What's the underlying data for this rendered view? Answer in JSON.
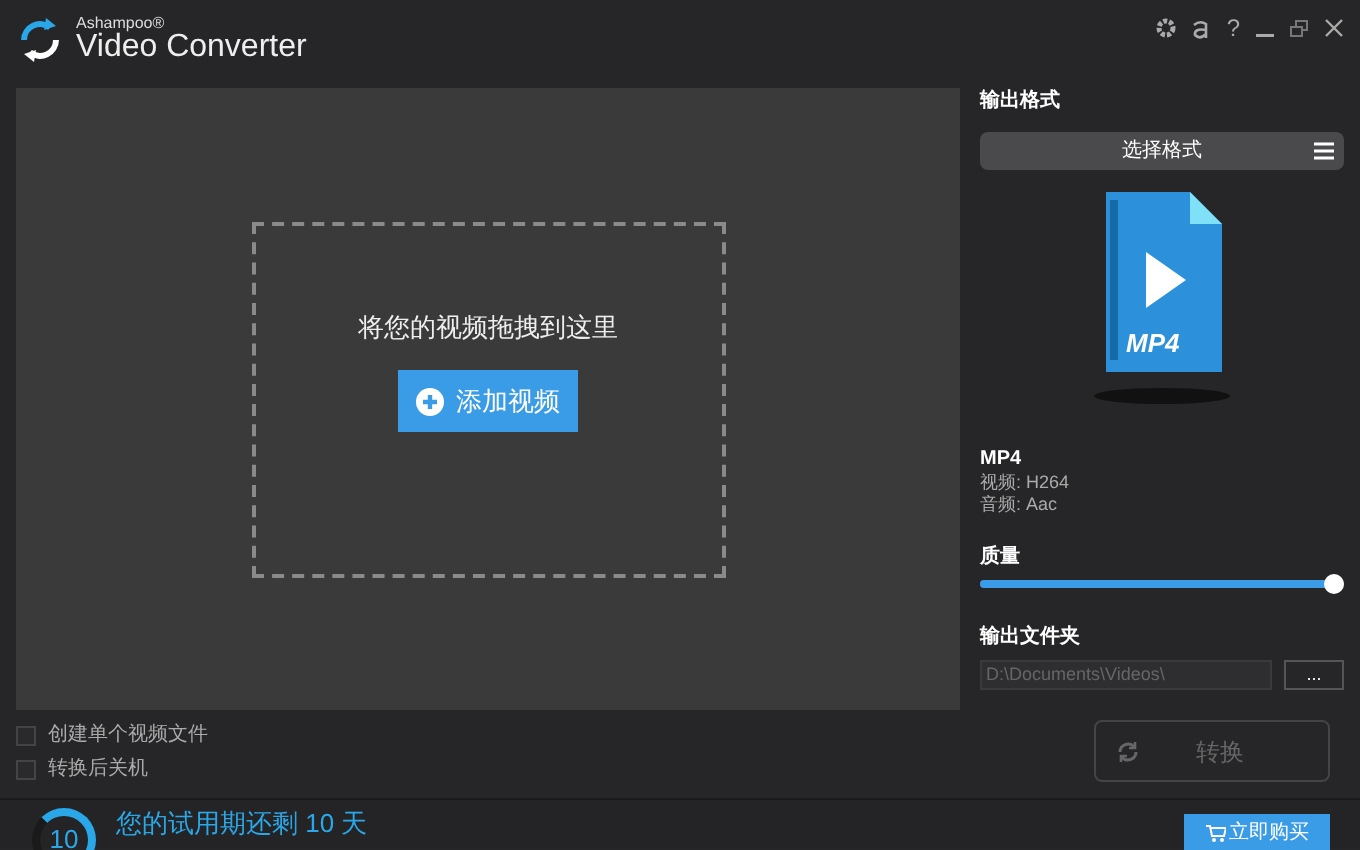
{
  "window": {
    "brand": "Ashampoo®",
    "title": "Video Converter",
    "controls": [
      "?"
    ]
  },
  "drop_area": {
    "hint": "将您的视频拖拽到这里",
    "add_button": "添加视频"
  },
  "output_format": {
    "heading": "输出格式",
    "select_button": "选择格式",
    "format_icon_label": "MP4",
    "name": "MP4",
    "video": "视频: H264",
    "audio": "音频: Aac"
  },
  "quality": {
    "label": "质量",
    "level": 1.0
  },
  "output_folder": {
    "label": "输出文件夹",
    "path": "D:\\Documents\\Videos\\",
    "browse_button": "..."
  },
  "options": [
    {
      "label": "创建单个视频文件",
      "checked": false
    },
    {
      "label": "转换后关机",
      "checked": false
    }
  ],
  "convert_button": {
    "label": "转换",
    "disabled": true
  },
  "trial": {
    "days": "10",
    "message": "您的试用期还剩 10 天",
    "buy_button": "立即购买"
  }
}
